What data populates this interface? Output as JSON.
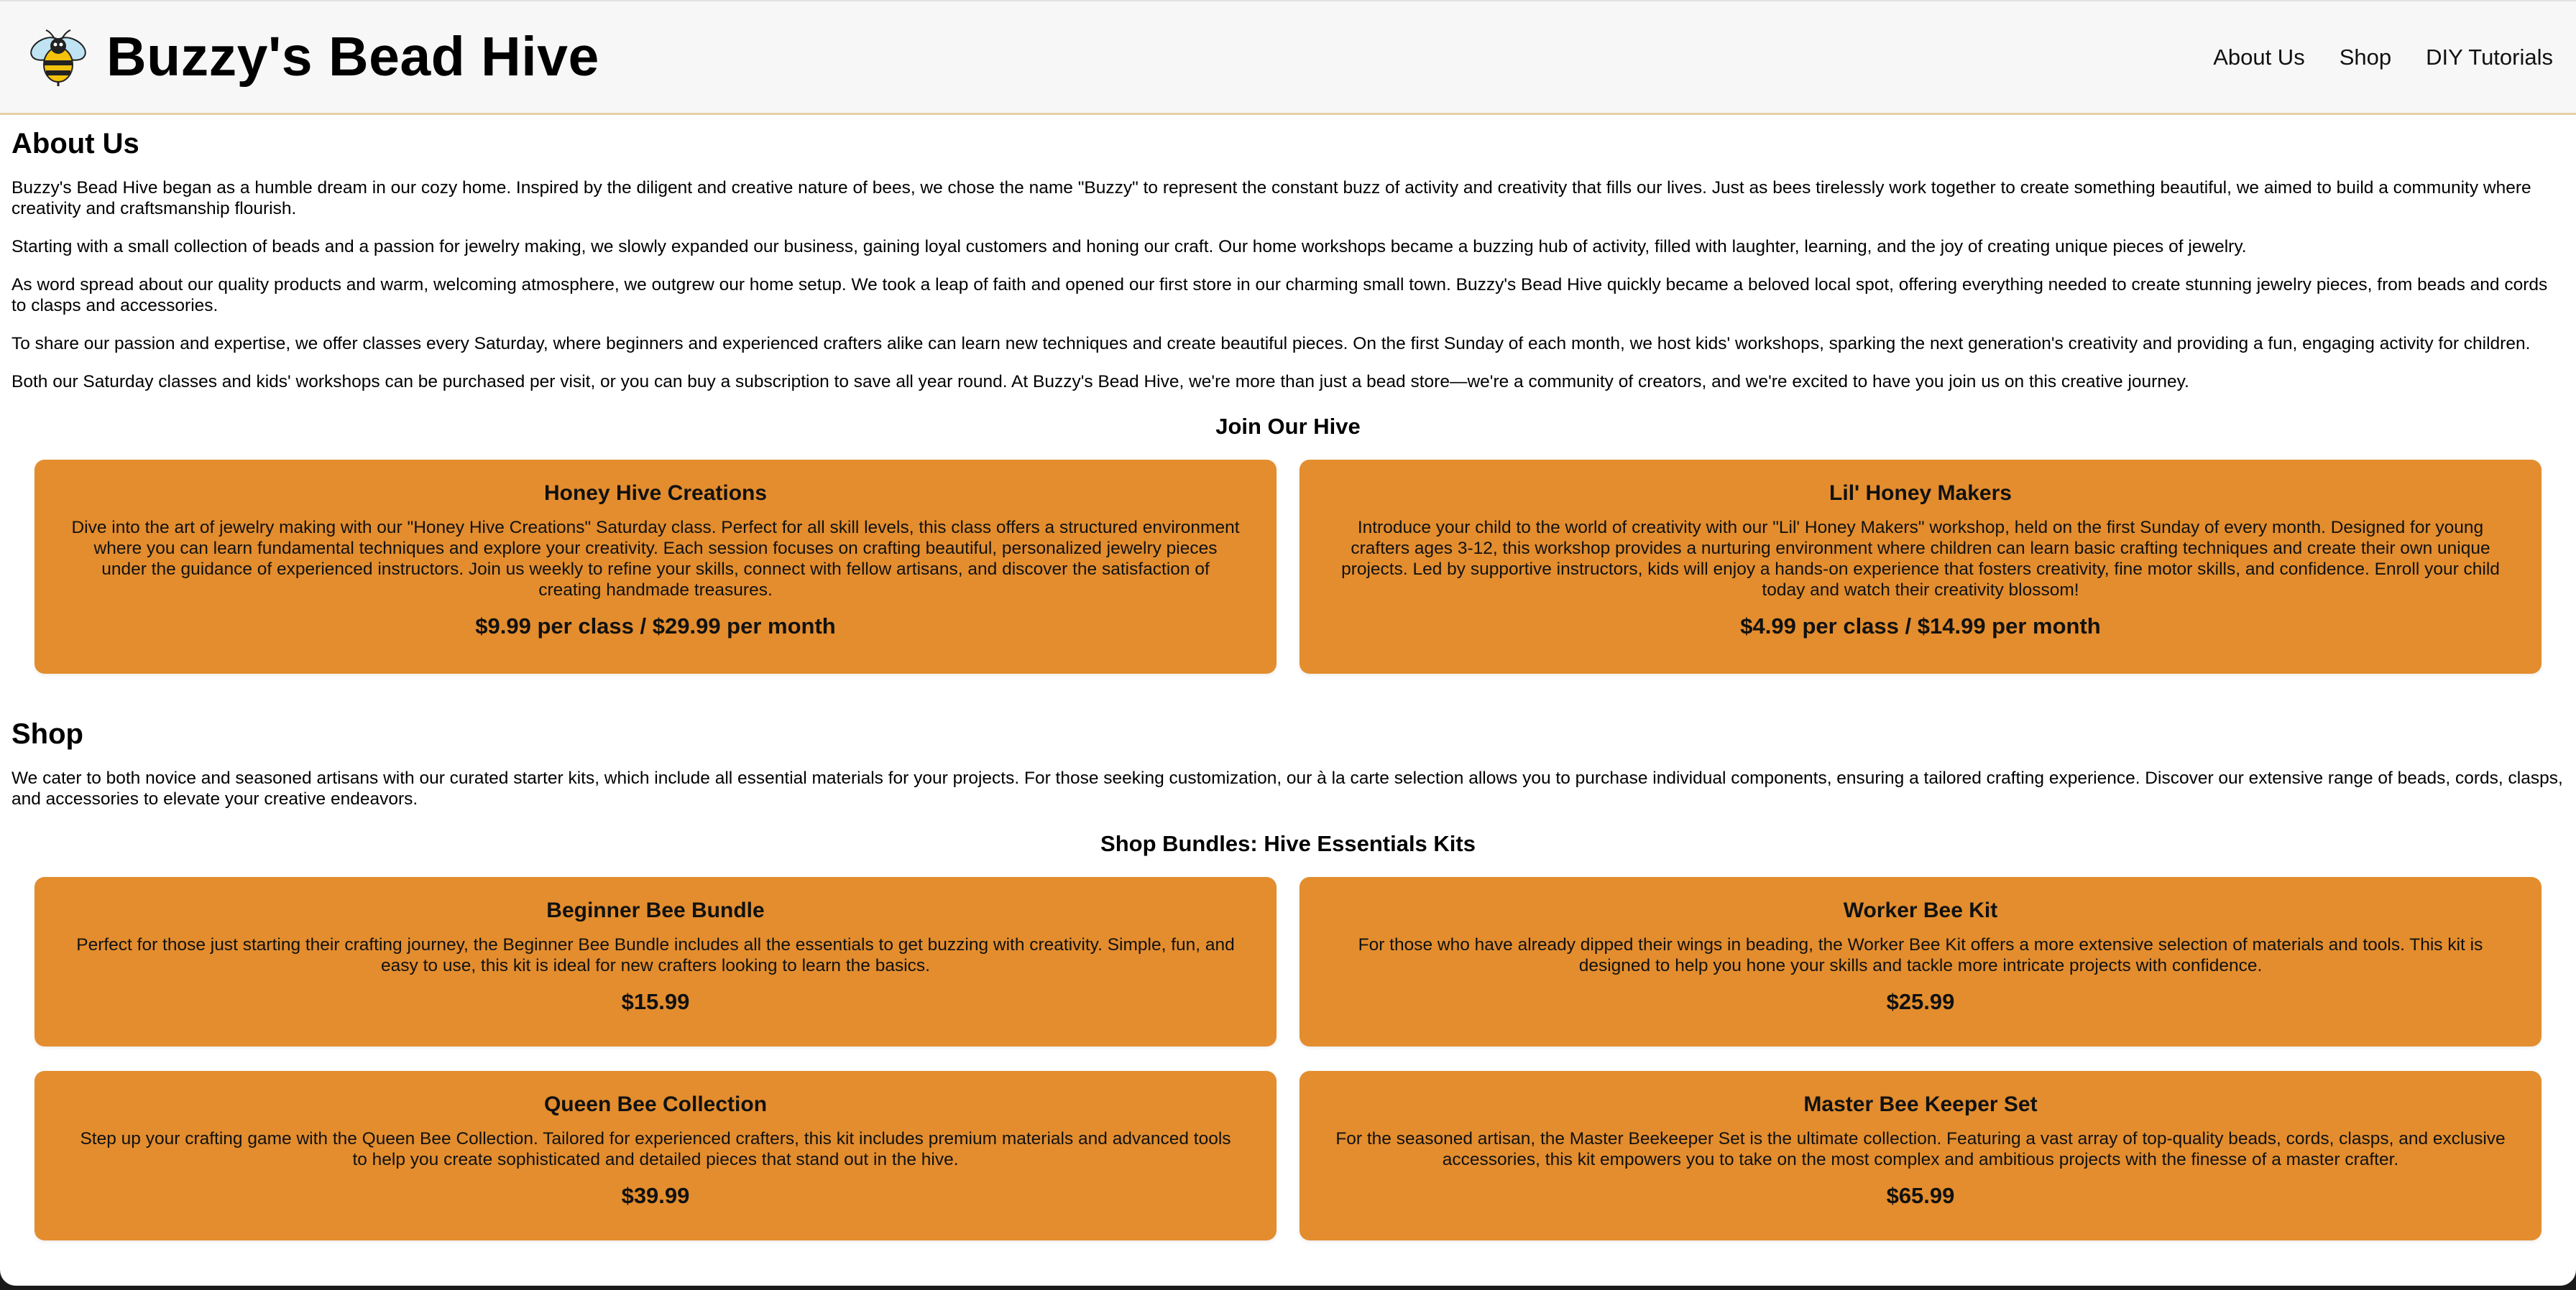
{
  "brand": {
    "title": "Buzzy's Bead Hive",
    "logo_icon": "bee-icon"
  },
  "nav": {
    "about": "About Us",
    "shop": "Shop",
    "tutorials": "DIY Tutorials"
  },
  "about": {
    "heading": "About Us",
    "paragraphs": [
      "Buzzy's Bead Hive began as a humble dream in our cozy home. Inspired by the diligent and creative nature of bees, we chose the name \"Buzzy\" to represent the constant buzz of activity and creativity that fills our lives. Just as bees tirelessly work together to create something beautiful, we aimed to build a community where creativity and craftsmanship flourish.",
      "Starting with a small collection of beads and a passion for jewelry making, we slowly expanded our business, gaining loyal customers and honing our craft. Our home workshops became a buzzing hub of activity, filled with laughter, learning, and the joy of creating unique pieces of jewelry.",
      "As word spread about our quality products and warm, welcoming atmosphere, we outgrew our home setup. We took a leap of faith and opened our first store in our charming small town. Buzzy's Bead Hive quickly became a beloved local spot, offering everything needed to create stunning jewelry pieces, from beads and cords to clasps and accessories.",
      "To share our passion and expertise, we offer classes every Saturday, where beginners and experienced crafters alike can learn new techniques and create beautiful pieces. On the first Sunday of each month, we host kids' workshops, sparking the next generation's creativity and providing a fun, engaging activity for children.",
      "Both our Saturday classes and kids' workshops can be purchased per visit, or you can buy a subscription to save all year round. At Buzzy's Bead Hive, we're more than just a bead store—we're a community of creators, and we're excited to have you join us on this creative journey."
    ],
    "join_heading": "Join Our Hive",
    "classes": [
      {
        "title": "Honey Hive Creations",
        "description": "Dive into the art of jewelry making with our \"Honey Hive Creations\" Saturday class. Perfect for all skill levels, this class offers a structured environment where you can learn fundamental techniques and explore your creativity. Each session focuses on crafting beautiful, personalized jewelry pieces under the guidance of experienced instructors. Join us weekly to refine your skills, connect with fellow artisans, and discover the satisfaction of creating handmade treasures.",
        "price": "$9.99 per class / $29.99 per month"
      },
      {
        "title": "Lil' Honey Makers",
        "description": "Introduce your child to the world of creativity with our \"Lil' Honey Makers\" workshop, held on the first Sunday of every month. Designed for young crafters ages 3-12, this workshop provides a nurturing environment where children can learn basic crafting techniques and create their own unique projects. Led by supportive instructors, kids will enjoy a hands-on experience that fosters creativity, fine motor skills, and confidence. Enroll your child today and watch their creativity blossom!",
        "price": "$4.99 per class / $14.99 per month"
      }
    ]
  },
  "shop": {
    "heading": "Shop",
    "intro": "We cater to both novice and seasoned artisans with our curated starter kits, which include all essential materials for your projects. For those seeking customization, our à la carte selection allows you to purchase individual components, ensuring a tailored crafting experience. Discover our extensive range of beads, cords, clasps, and accessories to elevate your creative endeavors.",
    "bundles_heading": "Shop Bundles: Hive Essentials Kits",
    "kits": [
      {
        "title": "Beginner Bee Bundle",
        "description": "Perfect for those just starting their crafting journey, the Beginner Bee Bundle includes all the essentials to get buzzing with creativity. Simple, fun, and easy to use, this kit is ideal for new crafters looking to learn the basics.",
        "price": "$15.99"
      },
      {
        "title": "Worker Bee Kit",
        "description": "For those who have already dipped their wings in beading, the Worker Bee Kit offers a more extensive selection of materials and tools. This kit is designed to help you hone your skills and tackle more intricate projects with confidence.",
        "price": "$25.99"
      },
      {
        "title": "Queen Bee Collection",
        "description": "Step up your crafting game with the Queen Bee Collection. Tailored for experienced crafters, this kit includes premium materials and advanced tools to help you create sophisticated and detailed pieces that stand out in the hive.",
        "price": "$39.99"
      },
      {
        "title": "Master Bee Keeper Set",
        "description": "For the seasoned artisan, the Master Beekeeper Set is the ultimate collection. Featuring a vast array of top-quality beads, cords, clasps, and exclusive accessories, this kit empowers you to take on the most complex and ambitious projects with the finesse of a master crafter.",
        "price": "$65.99"
      }
    ]
  },
  "colors": {
    "card": "#e38d2e",
    "header_bg": "#f7f7f7",
    "header_border": "#e6cfa8"
  }
}
